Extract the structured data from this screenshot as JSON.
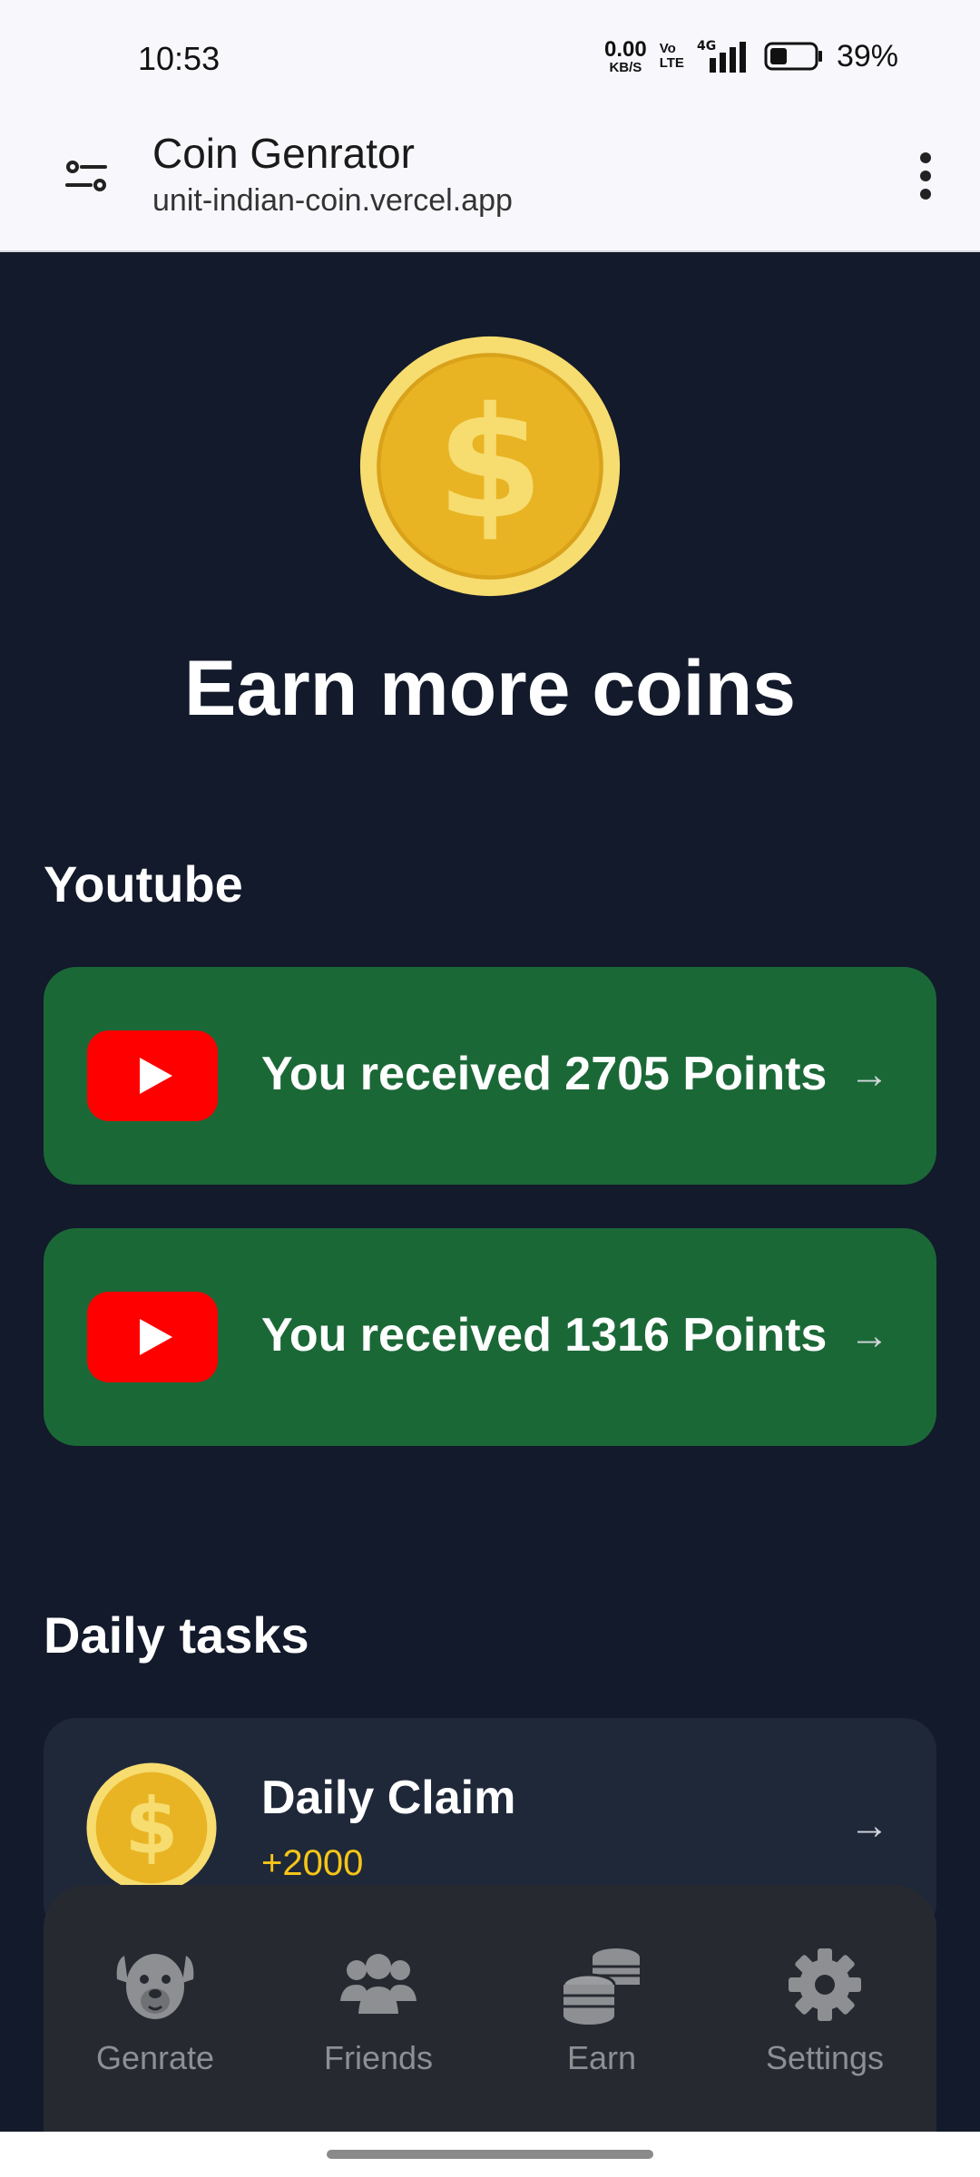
{
  "status_bar": {
    "time": "10:53",
    "net_speed_value": "0.00",
    "net_speed_unit": "KB/S",
    "volte_top": "Vo",
    "volte_bottom": "LTE",
    "network": "4G",
    "battery_percent": "39%",
    "battery_level": 0.39
  },
  "browser": {
    "title": "Coin Genrator",
    "url": "unit-indian-coin.vercel.app"
  },
  "hero": {
    "title": "Earn more coins"
  },
  "youtube": {
    "section_title": "Youtube",
    "cards": [
      {
        "text": "You received 2705 Points",
        "arrow": "→"
      },
      {
        "text": "You received 1316 Points",
        "arrow": "→"
      }
    ]
  },
  "daily_tasks": {
    "section_title": "Daily tasks",
    "items": [
      {
        "title": "Daily Claim",
        "reward": "+2000",
        "arrow": "→"
      }
    ]
  },
  "bottom_nav": {
    "items": [
      {
        "label": "Genrate",
        "icon": "dog-face-icon"
      },
      {
        "label": "Friends",
        "icon": "people-group-icon"
      },
      {
        "label": "Earn",
        "icon": "coins-stack-icon"
      },
      {
        "label": "Settings",
        "icon": "gear-icon"
      }
    ]
  },
  "colors": {
    "background": "#131a2b",
    "youtube_card": "#1b6837",
    "task_card": "#1f2839",
    "reward": "#f5c518",
    "nav_bg": "#262a30",
    "coin_gold": "#e8b423"
  }
}
